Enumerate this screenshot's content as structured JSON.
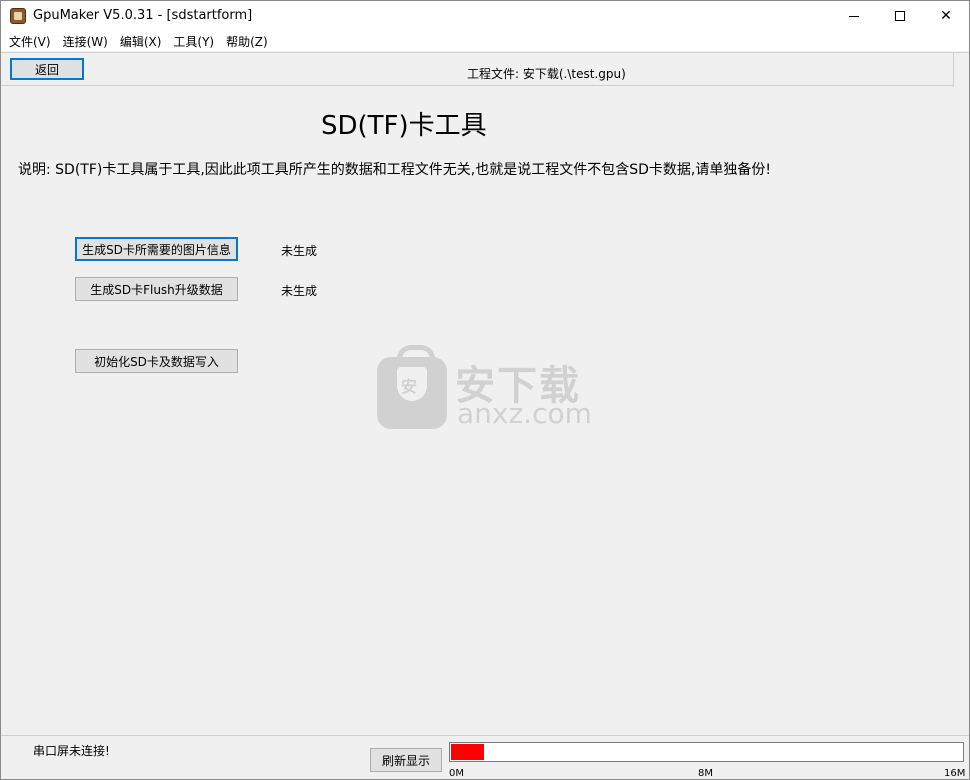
{
  "window": {
    "title": "GpuMaker V5.0.31 - [sdstartform]"
  },
  "menu": {
    "items": [
      "文件(V)",
      "连接(W)",
      "编辑(X)",
      "工具(Y)",
      "帮助(Z)"
    ]
  },
  "toolbar": {
    "back_label": "返回",
    "project_file": "工程文件: 安下载(.\\test.gpu)"
  },
  "main": {
    "title": "SD(TF)卡工具",
    "description": "说明: SD(TF)卡工具属于工具,因此此项工具所产生的数据和工程文件无关,也就是说工程文件不包含SD卡数据,请单独备份!",
    "buttons": {
      "gen_image_info": "生成SD卡所需要的图片信息",
      "gen_flush_data": "生成SD卡Flush升级数据",
      "init_sd": "初始化SD卡及数据写入"
    },
    "status_image_info": "未生成",
    "status_flush_data": "未生成"
  },
  "watermark": {
    "cn": "安下载",
    "en": "anxz.com",
    "shield": "安"
  },
  "statusbar": {
    "serial_status": "串口屏未连接!",
    "refresh_label": "刷新显示",
    "progress_fraction": 0.065,
    "progress_color": "#ff0000",
    "ticks": [
      "0M",
      "8M",
      "16M"
    ]
  },
  "icons": {
    "app": "gpumaker-app-icon",
    "minimize": "minimize-icon",
    "maximize": "maximize-icon",
    "close": "close-icon"
  }
}
